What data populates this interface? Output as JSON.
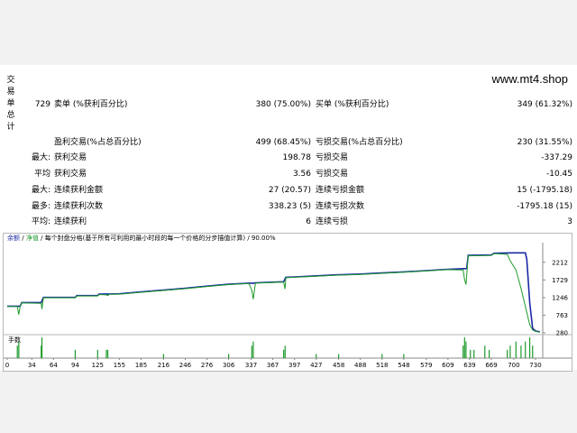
{
  "watermark": "www.mt4.shop",
  "side_label": [
    "交",
    "易",
    "单",
    "总",
    "计"
  ],
  "summary": {
    "total_trades": "729",
    "short_label": "卖单 (%获利百分比)",
    "short_value": "380 (75.00%)",
    "long_label": "买单 (%获利百分比)",
    "long_value": "349 (61.32%)",
    "profit_trades_label": "盈利交易(%占总百分比)",
    "profit_trades_value": "499 (68.45%)",
    "loss_trades_label": "亏损交易(%占总百分比)",
    "loss_trades_value": "230 (31.55%)"
  },
  "stats": [
    {
      "prefix": "最大:",
      "l_label": "获利交易",
      "l_value": "198.78",
      "r_label": "亏损交易",
      "r_value": "-337.29"
    },
    {
      "prefix": "平均",
      "l_label": "获利交易",
      "l_value": "3.56",
      "r_label": "亏损交易",
      "r_value": "-10.45"
    },
    {
      "prefix": "最大:",
      "l_label": "连续获利金额",
      "l_value": "27 (20.57)",
      "r_label": "连续亏损金额",
      "r_value": "15 (-1795.18)"
    },
    {
      "prefix": "最多:",
      "l_label": "连续获利次数",
      "l_value": "338.23 (5)",
      "r_label": "连续亏损次数",
      "r_value": "-1795.18 (15)"
    },
    {
      "prefix": "平均:",
      "l_label": "连续获利",
      "l_value": "6",
      "r_label": "连续亏损",
      "r_value": "3"
    }
  ],
  "chart_header": {
    "balance": "余额",
    "equity": "净值",
    "text": "/ 每个封盘分格(基于所有可利用的最小时段的每一个价格的分步描值计算) / 90.00%"
  },
  "lots_label": "手数",
  "chart_data": {
    "type": "line",
    "title": "",
    "ylim": [
      280,
      2700
    ],
    "y_ticks": [
      2212,
      1729,
      1246,
      763,
      280
    ],
    "x_ticks": [
      0,
      34,
      64,
      94,
      125,
      155,
      185,
      216,
      246,
      276,
      306,
      337,
      367,
      397,
      427,
      458,
      488,
      518,
      548,
      579,
      609,
      639,
      669,
      700,
      730
    ],
    "xlim": [
      0,
      740
    ],
    "series": [
      {
        "name": "余额",
        "color": "#1b28a5",
        "points": [
          [
            0,
            1010
          ],
          [
            18,
            1010
          ],
          [
            20,
            1110
          ],
          [
            47,
            1110
          ],
          [
            50,
            1250
          ],
          [
            94,
            1250
          ],
          [
            96,
            1300
          ],
          [
            125,
            1300
          ],
          [
            127,
            1340
          ],
          [
            155,
            1350
          ],
          [
            185,
            1400
          ],
          [
            216,
            1450
          ],
          [
            246,
            1500
          ],
          [
            276,
            1560
          ],
          [
            306,
            1610
          ],
          [
            334,
            1640
          ],
          [
            340,
            1640
          ],
          [
            343,
            1650
          ],
          [
            382,
            1680
          ],
          [
            385,
            1800
          ],
          [
            397,
            1810
          ],
          [
            427,
            1840
          ],
          [
            458,
            1870
          ],
          [
            488,
            1890
          ],
          [
            518,
            1920
          ],
          [
            548,
            1950
          ],
          [
            579,
            1985
          ],
          [
            609,
            2020
          ],
          [
            635,
            2040
          ],
          [
            637,
            2400
          ],
          [
            669,
            2410
          ],
          [
            673,
            2460
          ],
          [
            700,
            2470
          ],
          [
            716,
            2470
          ],
          [
            718,
            2300
          ],
          [
            722,
            1100
          ],
          [
            726,
            400
          ],
          [
            730,
            330
          ],
          [
            736,
            310
          ]
        ]
      },
      {
        "name": "净值",
        "color": "#1d9a2a",
        "points": [
          [
            0,
            1000
          ],
          [
            14,
            1000
          ],
          [
            16,
            780
          ],
          [
            18,
            1010
          ],
          [
            20,
            1100
          ],
          [
            47,
            1090
          ],
          [
            48,
            930
          ],
          [
            50,
            1240
          ],
          [
            94,
            1240
          ],
          [
            96,
            1290
          ],
          [
            125,
            1290
          ],
          [
            127,
            1330
          ],
          [
            137,
            1320
          ],
          [
            139,
            1300
          ],
          [
            141,
            1340
          ],
          [
            155,
            1340
          ],
          [
            185,
            1390
          ],
          [
            216,
            1440
          ],
          [
            246,
            1490
          ],
          [
            276,
            1550
          ],
          [
            306,
            1600
          ],
          [
            334,
            1630
          ],
          [
            338,
            1450
          ],
          [
            340,
            1200
          ],
          [
            343,
            1640
          ],
          [
            382,
            1670
          ],
          [
            384,
            1480
          ],
          [
            385,
            1790
          ],
          [
            397,
            1800
          ],
          [
            427,
            1830
          ],
          [
            458,
            1860
          ],
          [
            488,
            1880
          ],
          [
            518,
            1910
          ],
          [
            548,
            1940
          ],
          [
            579,
            1975
          ],
          [
            609,
            2010
          ],
          [
            630,
            2000
          ],
          [
            632,
            1740
          ],
          [
            634,
            1600
          ],
          [
            637,
            2390
          ],
          [
            669,
            2400
          ],
          [
            673,
            2450
          ],
          [
            691,
            2430
          ],
          [
            695,
            2250
          ],
          [
            703,
            2000
          ],
          [
            710,
            1500
          ],
          [
            716,
            1000
          ],
          [
            722,
            500
          ],
          [
            726,
            360
          ],
          [
            730,
            320
          ],
          [
            736,
            300
          ]
        ]
      }
    ],
    "volume_bars": [
      [
        14,
        3
      ],
      [
        16,
        4
      ],
      [
        47,
        3
      ],
      [
        48,
        5
      ],
      [
        94,
        2
      ],
      [
        125,
        2
      ],
      [
        137,
        2
      ],
      [
        139,
        2
      ],
      [
        216,
        1
      ],
      [
        306,
        1
      ],
      [
        338,
        3
      ],
      [
        340,
        4
      ],
      [
        382,
        2
      ],
      [
        384,
        3
      ],
      [
        427,
        1
      ],
      [
        458,
        1
      ],
      [
        518,
        1
      ],
      [
        548,
        1
      ],
      [
        630,
        3
      ],
      [
        632,
        5
      ],
      [
        634,
        4
      ],
      [
        640,
        2
      ],
      [
        645,
        2
      ],
      [
        660,
        3
      ],
      [
        666,
        2
      ],
      [
        691,
        2
      ],
      [
        695,
        3
      ],
      [
        703,
        4
      ],
      [
        710,
        3
      ],
      [
        716,
        4
      ],
      [
        722,
        5
      ],
      [
        726,
        3
      ]
    ]
  }
}
